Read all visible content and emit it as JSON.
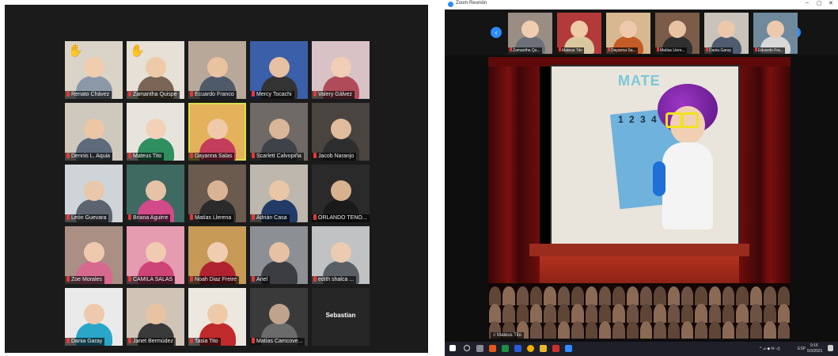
{
  "left_gallery": {
    "participants": [
      {
        "name": "Renato Chávez",
        "hand": "✋"
      },
      {
        "name": "Zamantha Quispe",
        "hand": "✋"
      },
      {
        "name": "Ecuardo Franco",
        "hand": ""
      },
      {
        "name": "Mercy Tocachi",
        "hand": ""
      },
      {
        "name": "Valery Gálvez",
        "hand": ""
      },
      {
        "name": "Dennis L. Aquia",
        "hand": ""
      },
      {
        "name": "Mateus Tito",
        "hand": ""
      },
      {
        "name": "Dayanna Salas",
        "hand": ""
      },
      {
        "name": "Scarlett Calvopiña",
        "hand": ""
      },
      {
        "name": "Jacob Naranjo",
        "hand": ""
      },
      {
        "name": "León Guevara",
        "hand": ""
      },
      {
        "name": "Briana Aguirre",
        "hand": ""
      },
      {
        "name": "Matías Llerena",
        "hand": ""
      },
      {
        "name": "Adrián Casa",
        "hand": ""
      },
      {
        "name": "ORLANDO TENO...",
        "hand": ""
      },
      {
        "name": "Zoe Morales",
        "hand": ""
      },
      {
        "name": "CAMILA SALAS",
        "hand": ""
      },
      {
        "name": "Noah Diaz Freire",
        "hand": ""
      },
      {
        "name": "Ariel",
        "hand": ""
      },
      {
        "name": "edith shalca ...",
        "hand": ""
      },
      {
        "name": "Dania Garay",
        "hand": ""
      },
      {
        "name": "Janet Bermúdez",
        "hand": ""
      },
      {
        "name": "Tasia Tito",
        "hand": ""
      },
      {
        "name": "Matías Camcove...",
        "hand": ""
      },
      {
        "name": "",
        "hand": ""
      }
    ],
    "video_off_name": "Sebastian"
  },
  "right_window": {
    "title": "Zoom Reunión",
    "minimize": "–",
    "maximize": "▢",
    "close": "✕",
    "prev_arrow": "‹",
    "next_arrow": "›",
    "thumbnails": [
      {
        "name": "Zamantha Qu..."
      },
      {
        "name": "Mateus Tito"
      },
      {
        "name": "Dayanna Sa..."
      },
      {
        "name": "Matías Llere..."
      },
      {
        "name": "Dania Garay"
      },
      {
        "name": "Eduardo Fra..."
      }
    ],
    "speaker_name": "Mateus Tito",
    "speaker_signal": "ıl",
    "wall_sign": "MATE",
    "poster_numbers": "1 2 3 4"
  },
  "taskbar": {
    "lang": "ESP",
    "time": "9:16",
    "date": "5/3/2021",
    "tray": "^ ⊿ ◆ ✉ ◁)"
  },
  "colors": {
    "zoom_blue": "#2d8cff",
    "active_speaker_border": "#d8e04a",
    "mic_muted": "#e03a3a"
  }
}
